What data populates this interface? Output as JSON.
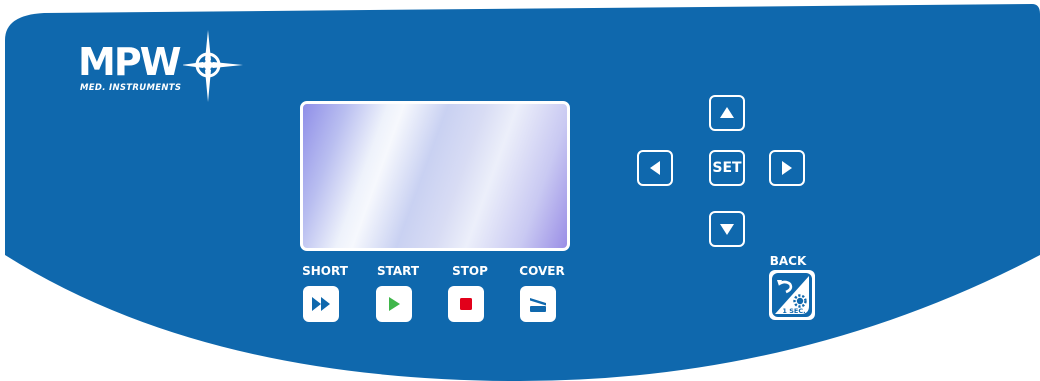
{
  "colors": {
    "panel_blue": "#0f68ad",
    "white": "#ffffff",
    "start_green": "#3fb64a",
    "stop_red": "#e2001a",
    "icon_blue": "#0f68ad"
  },
  "logo": {
    "text": "MPW",
    "subtitle": "MED. INSTRUMENTS",
    "icon": "compass-star-icon"
  },
  "display": {
    "state": "blank"
  },
  "navigation": {
    "up_icon": "arrow-up-icon",
    "down_icon": "arrow-down-icon",
    "left_icon": "arrow-left-icon",
    "right_icon": "arrow-right-icon",
    "set_label": "SET"
  },
  "back": {
    "label": "BACK",
    "badge": "1 SEC.",
    "icon": "back-settings-icon"
  },
  "function_buttons": {
    "short": {
      "label": "SHORT",
      "icon": "fast-forward-icon"
    },
    "start": {
      "label": "START",
      "icon": "play-icon"
    },
    "stop": {
      "label": "STOP",
      "icon": "stop-icon"
    },
    "cover": {
      "label": "COVER",
      "icon": "lid-open-icon"
    }
  }
}
